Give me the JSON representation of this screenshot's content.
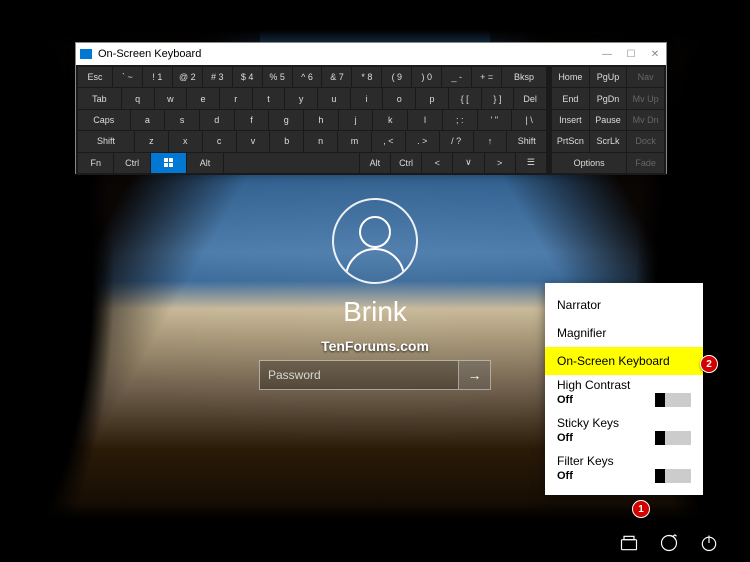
{
  "osk": {
    "title": "On-Screen Keyboard",
    "rows": [
      [
        "Esc",
        "` ~",
        "! 1",
        "@ 2",
        "# 3",
        "$ 4",
        "% 5",
        "^ 6",
        "& 7",
        "* 8",
        "( 9",
        ") 0",
        "_ -",
        "+ =",
        "Bksp"
      ],
      [
        "Tab",
        "q",
        "w",
        "e",
        "r",
        "t",
        "y",
        "u",
        "i",
        "o",
        "p",
        "{ [",
        "} ]",
        "Del"
      ],
      [
        "Caps",
        "a",
        "s",
        "d",
        "f",
        "g",
        "h",
        "j",
        "k",
        "l",
        "; :",
        "' \"",
        "| \\"
      ],
      [
        "Shift",
        "z",
        "x",
        "c",
        "v",
        "b",
        "n",
        "m",
        ", <",
        ". >",
        "/ ?",
        "↑",
        "Shift"
      ],
      [
        "Fn",
        "Ctrl",
        "",
        "Alt",
        "",
        "Alt",
        "Ctrl",
        "<",
        "∨",
        ">",
        "☰"
      ]
    ],
    "side": [
      [
        "Home",
        "PgUp",
        "Nav"
      ],
      [
        "End",
        "PgDn",
        "Mv Up"
      ],
      [
        "Insert",
        "Pause",
        "Mv Dn"
      ],
      [
        "PrtScn",
        "ScrLk",
        "Dock"
      ],
      [
        "Options",
        "",
        "Fade"
      ]
    ],
    "win_controls": {
      "min": "—",
      "max": "☐",
      "close": "✕"
    }
  },
  "login": {
    "username": "Brink",
    "watermark": "TenForums.com",
    "password_placeholder": "Password",
    "submit_glyph": "→"
  },
  "eoa": {
    "items": [
      "Narrator",
      "Magnifier",
      "On-Screen Keyboard"
    ],
    "highlighted_index": 2,
    "toggles": [
      {
        "label": "High Contrast",
        "state": "Off"
      },
      {
        "label": "Sticky Keys",
        "state": "Off"
      },
      {
        "label": "Filter Keys",
        "state": "Off"
      }
    ]
  },
  "badges": {
    "one": "1",
    "two": "2"
  },
  "tray": {
    "network": "network-icon",
    "ease": "ease-of-access-icon",
    "power": "power-icon"
  }
}
